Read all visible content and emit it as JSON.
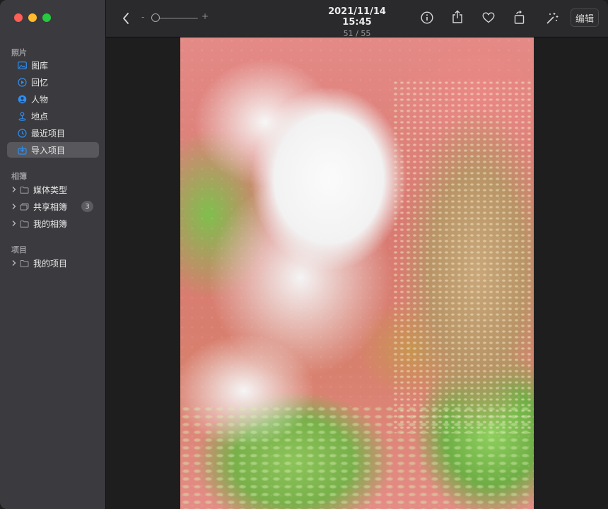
{
  "window": {
    "traffic_lights": [
      "close",
      "minimize",
      "zoom"
    ]
  },
  "sidebar": {
    "section_photos": "照片",
    "items": [
      {
        "label": "图库",
        "icon": "library-icon",
        "selected": false
      },
      {
        "label": "回忆",
        "icon": "memories-icon",
        "selected": false
      },
      {
        "label": "人物",
        "icon": "people-icon",
        "selected": false
      },
      {
        "label": "地点",
        "icon": "places-icon",
        "selected": false
      },
      {
        "label": "最近项目",
        "icon": "recents-icon",
        "selected": false
      },
      {
        "label": "导入项目",
        "icon": "imports-icon",
        "selected": true
      }
    ],
    "section_albums": "相簿",
    "albums": [
      {
        "label": "媒体类型",
        "icon": "folder-icon"
      },
      {
        "label": "共享相簿",
        "icon": "shared-album-icon",
        "badge": "3"
      },
      {
        "label": "我的相簿",
        "icon": "folder-icon"
      }
    ],
    "section_projects": "项目",
    "projects": [
      {
        "label": "我的项目",
        "icon": "folder-icon"
      }
    ]
  },
  "toolbar": {
    "zoom_minus": "-",
    "zoom_plus": "+",
    "zoom_level": 0,
    "title_date": "2021/11/14 15:45",
    "title_count": "51 / 55",
    "edit_label": "编辑"
  },
  "colors": {
    "sidebar_bg": "#3b3a3e",
    "toolbar_bg": "#2a2a2c",
    "main_bg": "#1e1e1e",
    "accent": "#2f8ff2"
  }
}
